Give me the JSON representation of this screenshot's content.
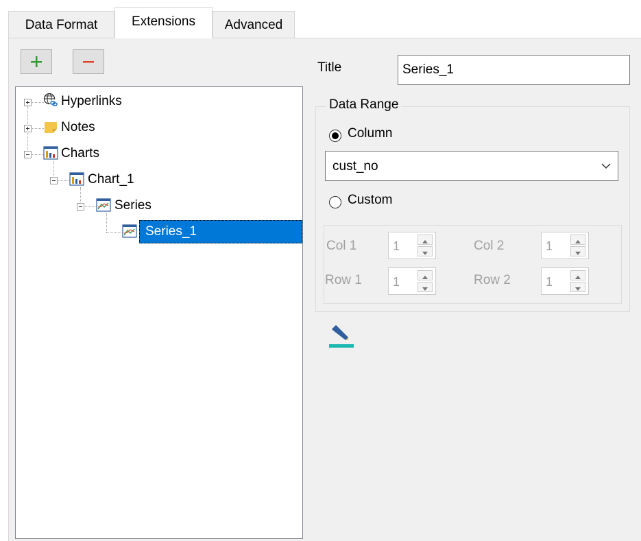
{
  "tabs": [
    {
      "label": "Data Format"
    },
    {
      "label": "Extensions"
    },
    {
      "label": "Advanced"
    }
  ],
  "toolbar": {
    "add_icon": "plus-icon",
    "remove_icon": "minus-icon"
  },
  "tree": {
    "items": [
      {
        "label": "Hyperlinks",
        "icon": "globe-link-icon"
      },
      {
        "label": "Notes",
        "icon": "note-icon"
      },
      {
        "label": "Charts",
        "icon": "chart-icon"
      },
      {
        "label": "Chart_1",
        "icon": "chart-icon"
      },
      {
        "label": "Series",
        "icon": "series-icon"
      },
      {
        "label": "Series_1",
        "icon": "series-icon",
        "selected": true
      }
    ]
  },
  "form": {
    "title_label": "Title",
    "title_value": "Series_1",
    "data_range_label": "Data Range",
    "column_label": "Column",
    "column_checked": true,
    "column_value": "cust_no",
    "custom_label": "Custom",
    "custom_checked": false,
    "col1_label": "Col 1",
    "col1_value": "1",
    "col2_label": "Col 2",
    "col2_value": "1",
    "row1_label": "Row 1",
    "row1_value": "1",
    "row2_label": "Row 2",
    "row2_value": "1",
    "edit_icon": "pencil-icon"
  },
  "colors": {
    "accent": "#0078d7",
    "add": "#2e9b2e",
    "remove": "#e0432c",
    "edit_underline": "#1cb8b0"
  }
}
